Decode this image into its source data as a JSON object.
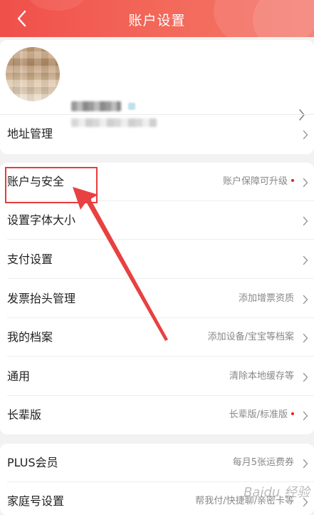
{
  "header": {
    "title": "账户设置"
  },
  "sections": [
    {
      "rows": [
        {
          "label": "地址管理",
          "hint": "",
          "dot": false
        }
      ]
    },
    {
      "rows": [
        {
          "label": "账户与安全",
          "hint": "账户保障可升级",
          "dot": true
        },
        {
          "label": "设置字体大小",
          "hint": "",
          "dot": false
        },
        {
          "label": "支付设置",
          "hint": "",
          "dot": false
        },
        {
          "label": "发票抬头管理",
          "hint": "添加增票资质",
          "dot": false
        },
        {
          "label": "我的档案",
          "hint": "添加设备/宝宝等档案",
          "dot": false
        },
        {
          "label": "通用",
          "hint": "清除本地缓存等",
          "dot": false
        },
        {
          "label": "长辈版",
          "hint": "长辈版/标准版",
          "dot": true
        }
      ]
    },
    {
      "rows": [
        {
          "label": "PLUS会员",
          "hint": "每月5张运费券",
          "dot": false
        },
        {
          "label": "家庭号设置",
          "hint": "帮我付/快捷聊/亲密卡等",
          "dot": false
        }
      ]
    }
  ],
  "watermark": "Baidu 经验",
  "colors": {
    "header": "#f04f4a",
    "accent_dot": "#e2231a",
    "annotation": "#e53c3c"
  }
}
